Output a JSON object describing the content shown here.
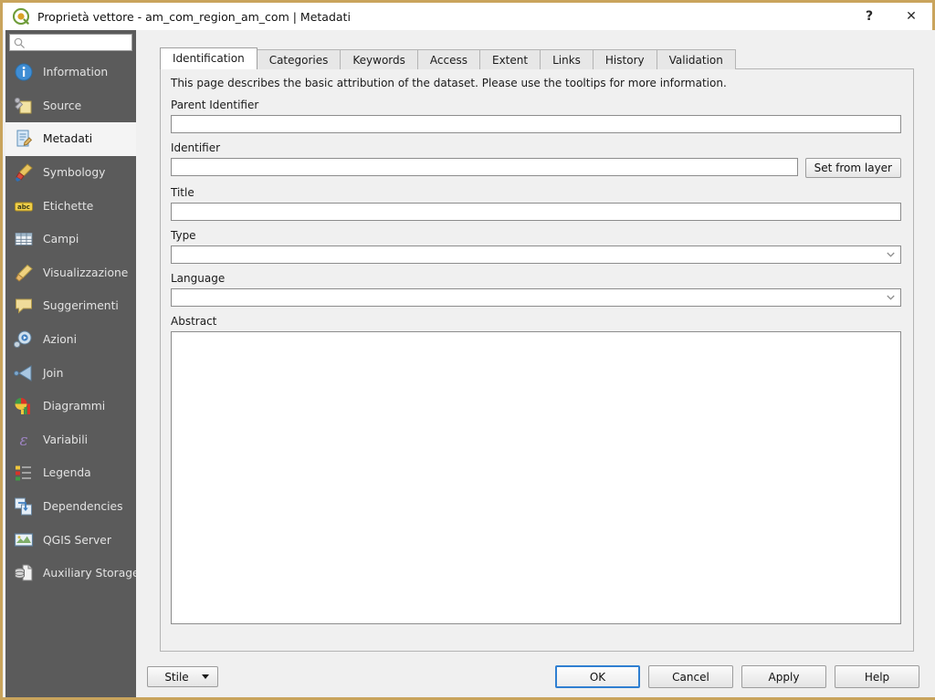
{
  "window": {
    "title": "Proprietà vettore - am_com_region_am_com | Metadati",
    "app_icon": "qgis-logo-icon",
    "help_button": "?",
    "close_button": "✕"
  },
  "sidebar": {
    "search": {
      "value": "",
      "placeholder": "",
      "icon": "search-icon"
    },
    "items": [
      {
        "label": "Information",
        "icon": "information-icon",
        "selected": false
      },
      {
        "label": "Source",
        "icon": "source-icon",
        "selected": false
      },
      {
        "label": "Metadati",
        "icon": "metadata-icon",
        "selected": true
      },
      {
        "label": "Symbology",
        "icon": "symbology-icon",
        "selected": false
      },
      {
        "label": "Etichette",
        "icon": "labels-icon",
        "selected": false
      },
      {
        "label": "Campi",
        "icon": "fields-icon",
        "selected": false
      },
      {
        "label": "Visualizzazione",
        "icon": "rendering-icon",
        "selected": false
      },
      {
        "label": "Suggerimenti",
        "icon": "display-hints-icon",
        "selected": false
      },
      {
        "label": "Azioni",
        "icon": "actions-icon",
        "selected": false
      },
      {
        "label": "Join",
        "icon": "joins-icon",
        "selected": false
      },
      {
        "label": "Diagrammi",
        "icon": "diagrams-icon",
        "selected": false
      },
      {
        "label": "Variabili",
        "icon": "variables-icon",
        "selected": false
      },
      {
        "label": "Legenda",
        "icon": "legend-icon",
        "selected": false
      },
      {
        "label": "Dependencies",
        "icon": "dependencies-icon",
        "selected": false
      },
      {
        "label": "QGIS Server",
        "icon": "qgis-server-icon",
        "selected": false
      },
      {
        "label": "Auxiliary Storage",
        "icon": "auxiliary-storage-icon",
        "selected": false
      }
    ]
  },
  "tabs": [
    {
      "label": "Identification",
      "active": true
    },
    {
      "label": "Categories",
      "active": false
    },
    {
      "label": "Keywords",
      "active": false
    },
    {
      "label": "Access",
      "active": false
    },
    {
      "label": "Extent",
      "active": false
    },
    {
      "label": "Links",
      "active": false
    },
    {
      "label": "History",
      "active": false
    },
    {
      "label": "Validation",
      "active": false
    }
  ],
  "identification": {
    "intro": "This page describes the basic attribution of the dataset. Please use the tooltips for more information.",
    "parent_identifier": {
      "label": "Parent Identifier",
      "value": "",
      "placeholder": ""
    },
    "identifier": {
      "label": "Identifier",
      "value": "",
      "placeholder": ""
    },
    "set_from_layer_button": "Set from layer",
    "title": {
      "label": "Title",
      "value": "",
      "placeholder": ""
    },
    "type": {
      "label": "Type",
      "value": "",
      "icon": "chevron-down-icon"
    },
    "language": {
      "label": "Language",
      "value": "",
      "icon": "chevron-down-icon"
    },
    "abstract": {
      "label": "Abstract",
      "value": "",
      "placeholder": ""
    }
  },
  "footer": {
    "style_button": "Stile",
    "style_caret": "caret-down-icon",
    "ok_button": "OK",
    "cancel_button": "Cancel",
    "apply_button": "Apply",
    "help_button": "Help"
  },
  "colors": {
    "window_border": "#c9a45c",
    "sidebar_bg": "#5b5b5b",
    "sidebar_selected_bg": "#f4f4f4",
    "content_bg": "#f0f0f0",
    "default_button_border": "#2f7fd1"
  }
}
